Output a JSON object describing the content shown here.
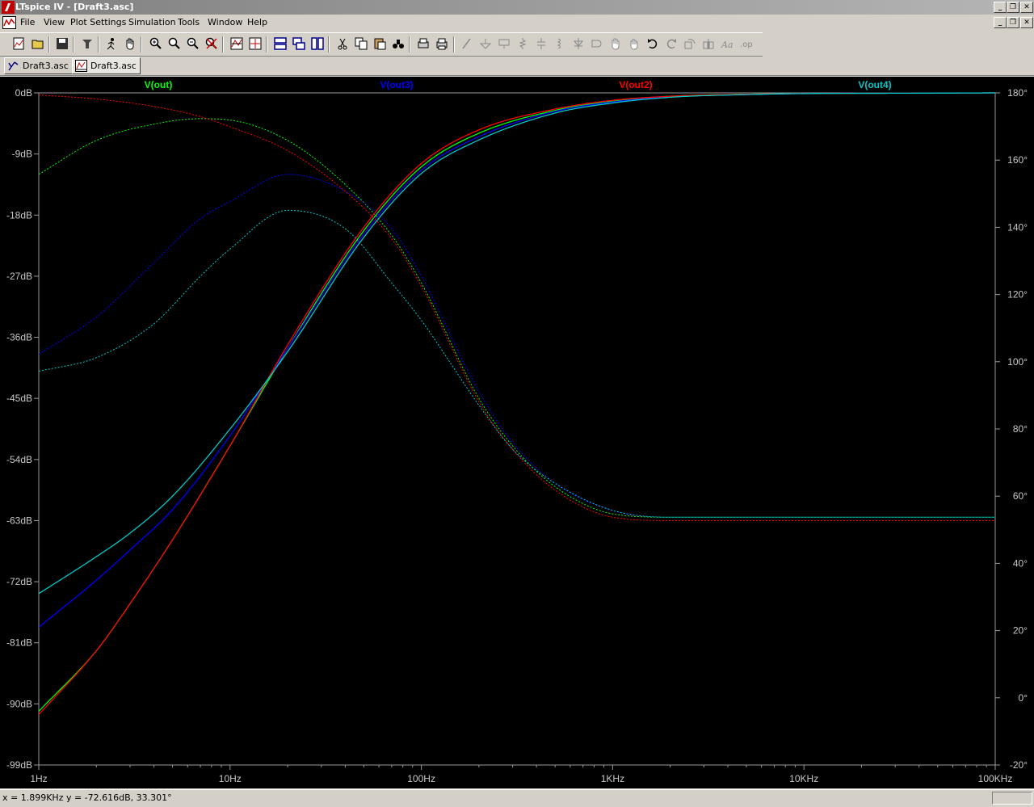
{
  "window": {
    "title": "LTspice IV - [Draft3.asc]"
  },
  "menu": [
    {
      "label": "File"
    },
    {
      "label": "View"
    },
    {
      "label": "Plot Settings"
    },
    {
      "label": "Simulation"
    },
    {
      "label": "Tools"
    },
    {
      "label": "Window"
    },
    {
      "label": "Help"
    }
  ],
  "toolbar_icons": [
    "new-schematic-icon",
    "open-icon",
    "save-icon",
    "control-panel-icon",
    "run-icon",
    "pan-icon",
    "zoom-in-icon",
    "zoom-area-icon",
    "zoom-out-icon",
    "zoom-full-icon",
    "autorange-icon",
    "plot-setup-icon",
    "tile-horizontal-icon",
    "cascade-icon",
    "tile-vertical-icon",
    "cut-icon",
    "copy-icon",
    "paste-icon",
    "find-icon",
    "print-preview-icon",
    "print-icon",
    "wire-icon",
    "ground-icon",
    "label-icon",
    "resistor-icon",
    "capacitor-icon",
    "inductor-icon",
    "diode-icon",
    "component-icon",
    "move-icon",
    "drag-icon",
    "undo-icon",
    "redo-icon",
    "rotate-icon",
    "mirror-icon",
    "text-icon",
    "spice-directive-icon"
  ],
  "tabs": [
    {
      "label": "Draft3.asc",
      "icon": "schematic-icon"
    },
    {
      "label": "Draft3.asc",
      "icon": "waveform-icon"
    }
  ],
  "status": {
    "text": "x = 1.899KHz    y = -72.616dB, 33.301°"
  },
  "chart_data": {
    "type": "line",
    "title": "",
    "xscale": "log",
    "xlim": [
      1,
      100000
    ],
    "xticks": [
      "1Hz",
      "10Hz",
      "100Hz",
      "1KHz",
      "10KHz",
      "100KHz"
    ],
    "ylim": [
      -99,
      0
    ],
    "yticks": [
      "0dB",
      "-9dB",
      "-18dB",
      "-27dB",
      "-36dB",
      "-45dB",
      "-54dB",
      "-63dB",
      "-72dB",
      "-81dB",
      "-90dB",
      "-99dB"
    ],
    "y2lim": [
      -20,
      180
    ],
    "y2ticks": [
      "180°",
      "160°",
      "140°",
      "120°",
      "100°",
      "80°",
      "60°",
      "40°",
      "20°",
      "0°",
      "-20°"
    ],
    "background": "#000000",
    "grid": false,
    "legend_position": "top",
    "series": [
      {
        "name": "V(out)",
        "color": "#00ff00",
        "magnitude_dB": {
          "x": [
            1,
            2,
            4,
            7,
            10,
            20,
            40,
            70,
            100,
            200,
            300,
            500,
            1000,
            2000
          ],
          "y": [
            -12,
            -7,
            -4.6,
            -3.8,
            -4,
            -7,
            -13.5,
            -21,
            -28,
            -45,
            -52,
            -58,
            -62,
            -62.5
          ]
        },
        "phase_deg": {
          "x": [
            1,
            2,
            3,
            5,
            10,
            20,
            50,
            100,
            200,
            500,
            1000,
            2000,
            5000,
            10000,
            30000,
            100000
          ],
          "y": [
            -4,
            14,
            28,
            47,
            75,
            104,
            139,
            158,
            168,
            174.8,
            177.5,
            179,
            179.6,
            179.8,
            179.9,
            180
          ]
        }
      },
      {
        "name": "V(out3)",
        "color": "#0000ff",
        "magnitude_dB": {
          "x": [
            1,
            2,
            4,
            7,
            10,
            20,
            40,
            70,
            100,
            200,
            300,
            500,
            1000,
            2000
          ],
          "y": [
            -38.5,
            -33,
            -25,
            -18.5,
            -16,
            -12,
            -14.5,
            -20,
            -27,
            -44,
            -51.5,
            -57.5,
            -61.5,
            -62.5
          ]
        },
        "phase_deg": {
          "x": [
            1,
            2,
            3,
            5,
            10,
            20,
            50,
            100,
            200,
            500,
            1000,
            2000,
            5000,
            10000,
            30000,
            100000
          ],
          "y": [
            21,
            35,
            44,
            56,
            78,
            104,
            138,
            157,
            167,
            174.5,
            177.3,
            178.8,
            179.5,
            179.8,
            179.9,
            180
          ]
        }
      },
      {
        "name": "V(out2)",
        "color": "#ff0000",
        "magnitude_dB": {
          "x": [
            1,
            2,
            4,
            7,
            10,
            20,
            40,
            70,
            100,
            200,
            300,
            500,
            1000,
            2000
          ],
          "y": [
            -0.3,
            -0.9,
            -2,
            -3.5,
            -5,
            -8.5,
            -14.5,
            -21.5,
            -28.5,
            -45.5,
            -52.5,
            -58.5,
            -62.5,
            -63
          ]
        },
        "phase_deg": {
          "x": [
            1,
            2,
            3,
            5,
            10,
            20,
            50,
            100,
            200,
            500,
            1000,
            2000,
            5000,
            10000,
            30000,
            100000
          ],
          "y": [
            -5,
            14,
            28,
            47,
            75,
            105,
            140,
            159,
            169,
            175.2,
            177.8,
            179,
            179.6,
            179.8,
            179.9,
            180
          ]
        }
      },
      {
        "name": "V(out4)",
        "color": "#00c8c8",
        "magnitude_dB": {
          "x": [
            1,
            2,
            4,
            7,
            10,
            20,
            40,
            70,
            100,
            200,
            300,
            500,
            1000,
            2000
          ],
          "y": [
            -41,
            -39,
            -34,
            -27,
            -23,
            -17.3,
            -20,
            -28,
            -33.5,
            -46,
            -52.5,
            -57.5,
            -61.5,
            -62.5
          ]
        },
        "phase_deg": {
          "x": [
            1,
            2,
            3,
            5,
            10,
            20,
            50,
            100,
            200,
            500,
            1000,
            2000,
            5000,
            10000,
            30000,
            100000
          ],
          "y": [
            31,
            42,
            49,
            60,
            80,
            103,
            137,
            156,
            166,
            174,
            177,
            178.7,
            179.5,
            179.8,
            179.9,
            180
          ]
        }
      }
    ]
  }
}
